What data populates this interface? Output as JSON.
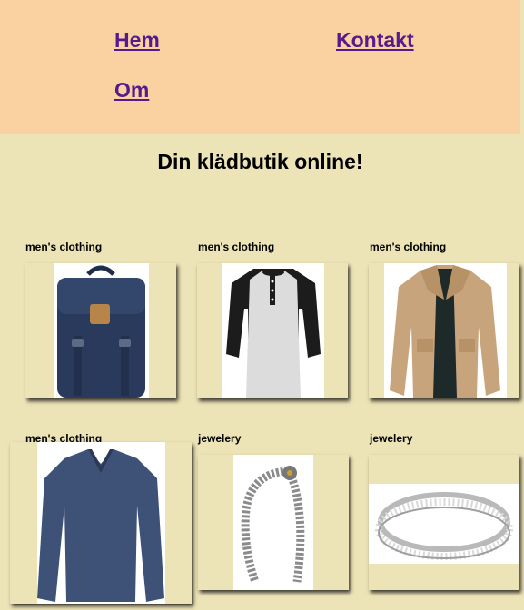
{
  "nav": {
    "home": "Hem",
    "contact": "Kontakt",
    "about": "Om"
  },
  "title": "Din klädbutik online!",
  "products": [
    {
      "category": "men's clothing",
      "image": "backpack-image"
    },
    {
      "category": "men's clothing",
      "image": "henley-shirt-image"
    },
    {
      "category": "men's clothing",
      "image": "jacket-image"
    },
    {
      "category": "men's clothing",
      "image": "long-sleeve-shirt-image"
    },
    {
      "category": "jewelery",
      "image": "chain-bracelet-image"
    },
    {
      "category": "jewelery",
      "image": "ring-image"
    }
  ],
  "colors": {
    "nav_bg": "#fad1a1",
    "page_bg": "#ece3b6",
    "link": "#551a8b"
  }
}
